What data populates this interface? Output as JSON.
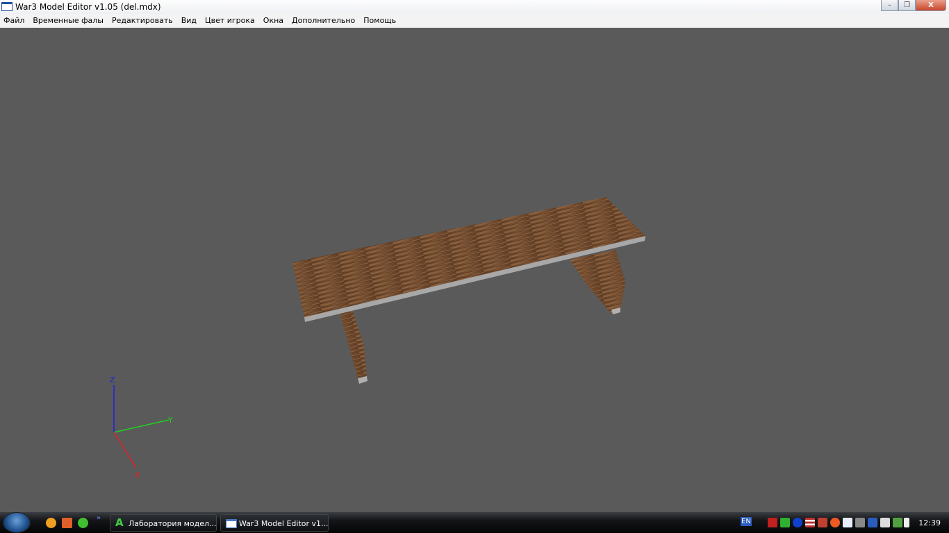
{
  "window": {
    "title": "War3 Model Editor v1.05 (del.mdx)",
    "controls": {
      "minimize": "–",
      "maximize": "❐",
      "close": "X"
    }
  },
  "menu": [
    "Файл",
    "Временные фалы",
    "Редактировать",
    "Вид",
    "Цвет игрока",
    "Окна",
    "Дополнительно",
    "Помощь"
  ],
  "viewport": {
    "background": "#5a5a5a",
    "axes": {
      "z": "Z",
      "y": "Y",
      "x": "X",
      "z_color": "#2020e0",
      "y_color": "#20d020",
      "x_color": "#e02020"
    }
  },
  "taskbar": {
    "quicklaunch": [
      "avast-icon",
      "eye-icon",
      "icq-icon"
    ],
    "more": "»",
    "tasks": [
      {
        "label": "Лаборатория модел..."
      },
      {
        "label": "War3 Model Editor v1..."
      }
    ],
    "language": "EN",
    "tray_icons": [
      "antivirus-icon",
      "lab-icon",
      "browser-icon",
      "flag-icon",
      "speaker-muted-icon",
      "alert-icon",
      "vk-icon",
      "network-icon",
      "bluetooth-icon",
      "volume-icon",
      "safely-remove-icon",
      "power-icon"
    ],
    "clock": "12:39"
  }
}
